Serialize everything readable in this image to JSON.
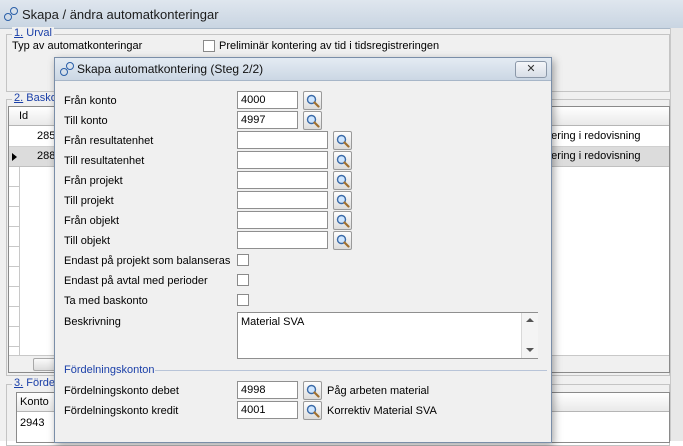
{
  "outer": {
    "title": "Skapa / ändra automatkonteringar",
    "section1": {
      "number": "1.",
      "label": " Urval"
    },
    "type_label": "Typ av automatkonteringar",
    "prelim_label": "Preliminär kontering av tid i tidsregistreringen",
    "section2": {
      "number": "2.",
      "label": " Basko"
    },
    "grid_header_id": "Id",
    "rows": [
      {
        "id": "285",
        "desc": "ntering i redovisning"
      },
      {
        "id": "288",
        "desc": "ntering i redovisning"
      }
    ],
    "section3": {
      "number": "3.",
      "label": " Förde"
    },
    "grid3_header": "Konto",
    "grid3_row": "2943"
  },
  "dialog": {
    "title": "Skapa automatkontering  (Steg 2/2)",
    "close": "✕",
    "fields": {
      "fran_konto": {
        "label": "Från konto",
        "value": "4000"
      },
      "till_konto": {
        "label": "Till konto",
        "value": "4997"
      },
      "fran_resultatenhet": {
        "label": "Från resultatenhet",
        "value": ""
      },
      "till_resultatenhet": {
        "label": "Till resultatenhet",
        "value": ""
      },
      "fran_projekt": {
        "label": "Från projekt",
        "value": ""
      },
      "till_projekt": {
        "label": "Till projekt",
        "value": ""
      },
      "fran_objekt": {
        "label": "Från objekt",
        "value": ""
      },
      "till_objekt": {
        "label": "Till objekt",
        "value": ""
      }
    },
    "checks": {
      "balanseras": "Endast på projekt som balanseras",
      "avtal": "Endast på avtal med perioder",
      "baskonto": "Ta med baskonto"
    },
    "beskrivning": {
      "label": "Beskrivning",
      "value": "Material SVA"
    },
    "fordelning": {
      "heading": "Fördelningskonton",
      "debet": {
        "label": "Fördelningskonto debet",
        "value": "4998",
        "name": "Påg arbeten material"
      },
      "kredit": {
        "label": "Fördelningskonto kredit",
        "value": "4001",
        "name": "Korrektiv Material SVA"
      }
    }
  }
}
